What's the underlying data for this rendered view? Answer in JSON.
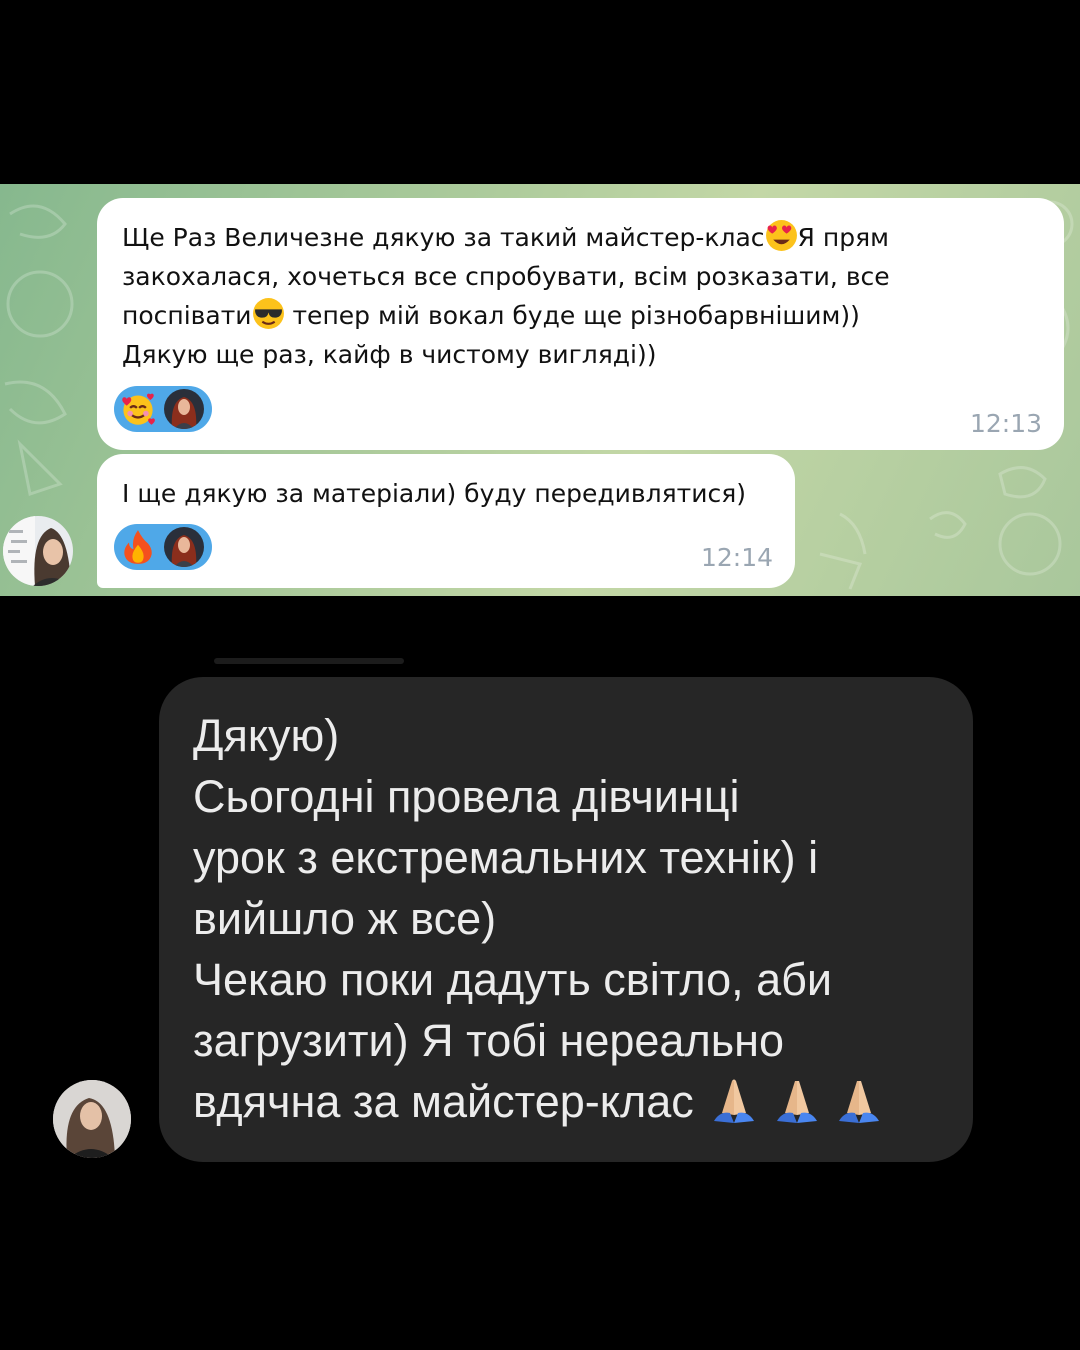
{
  "telegram": {
    "messages": [
      {
        "text_1": "Ще Раз Величезне дякую за такий майстер-клас",
        "emoji_1": "heart-eyes-emoji",
        "text_2": "Я прям\nзакохалася, хочеться все спробувати, всім розказати, все\nпоспівати",
        "emoji_2": "sunglasses-emoji",
        "text_3": " тепер мій вокал буде ще різнобарвнішим))\nДякую ще раз, кайф в чистому вигляді))",
        "reaction": "smiling-face-with-hearts-emoji",
        "time": "12:13"
      },
      {
        "text": "І ще дякую за матеріали) буду передивлятися)",
        "reaction": "fire-emoji",
        "time": "12:14"
      }
    ],
    "colors": {
      "bubble": "#ffffff",
      "reaction_pill": "#4fa8e8",
      "time": "#9aa6b2"
    }
  },
  "instagram": {
    "message": "Дякую)\nСьогодні провела дівчинці\nурок з екстремальних технік) і\nвийшло ж все)\nЧекаю поки дадуть світло, аби\nзагрузити) Я тобі нереально\nвдячна за майстер-клас",
    "trailing_emoji": [
      "folded-hands-emoji",
      "folded-hands-emoji",
      "folded-hands-emoji"
    ],
    "colors": {
      "bubble": "#262626",
      "text": "#ececec",
      "background": "#000000"
    }
  }
}
